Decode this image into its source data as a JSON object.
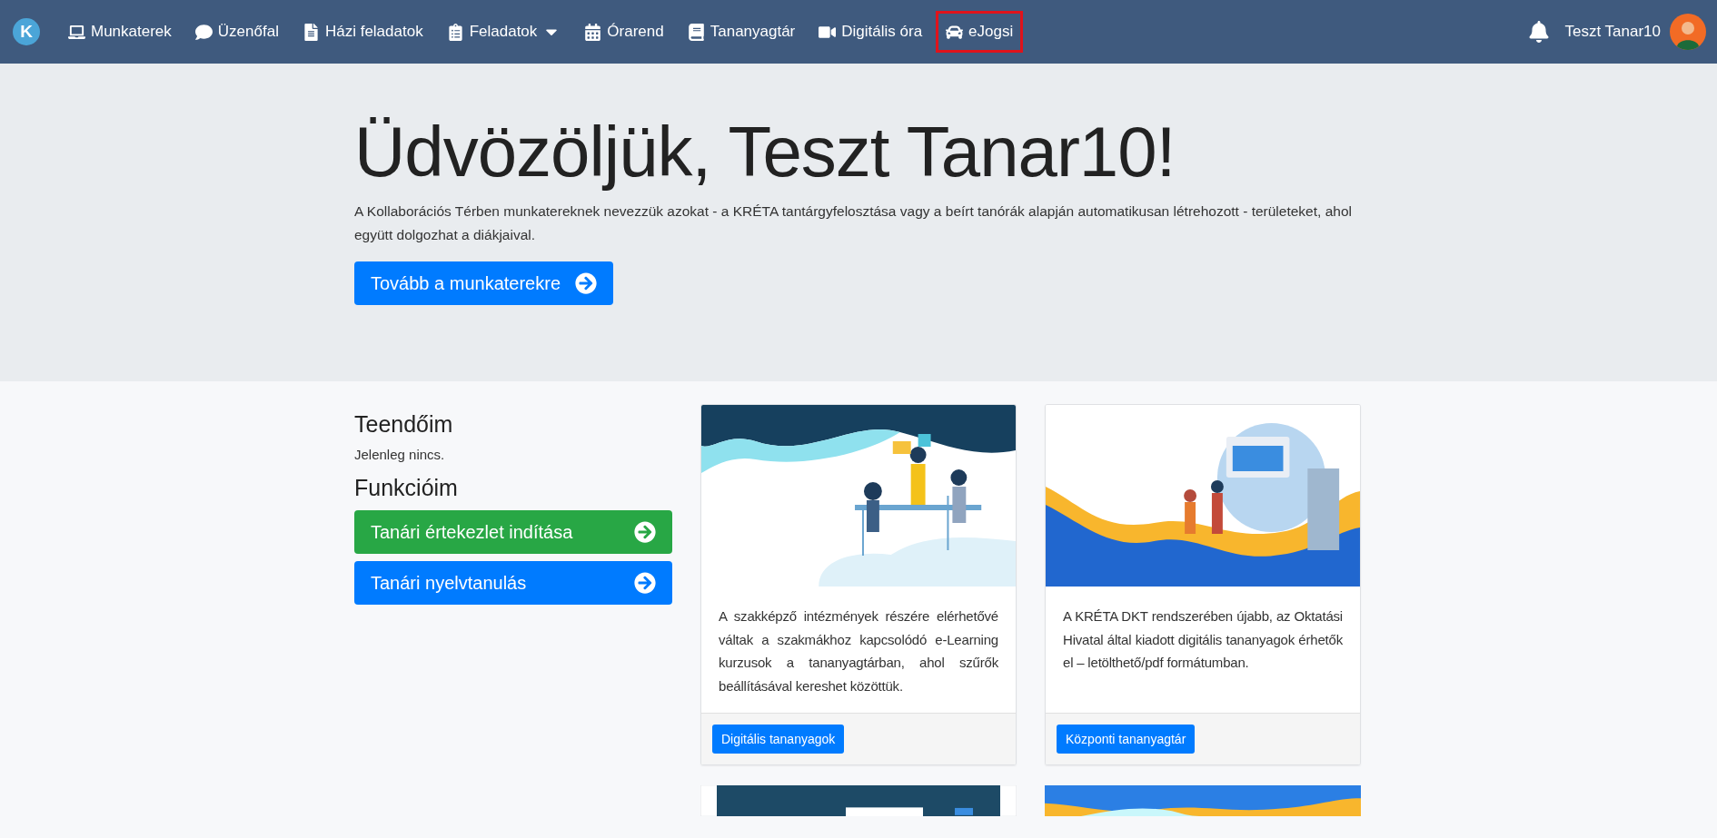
{
  "navbar": {
    "logo": "K",
    "items": [
      {
        "label": "Munkaterek",
        "kind": "link",
        "highlighted": false
      },
      {
        "label": "Üzenőfal",
        "kind": "link",
        "highlighted": false
      },
      {
        "label": "Házi feladatok",
        "kind": "link",
        "highlighted": false
      },
      {
        "label": "Feladatok",
        "kind": "dropdown",
        "highlighted": false
      },
      {
        "label": "Órarend",
        "kind": "link",
        "highlighted": false
      },
      {
        "label": "Tananyagtár",
        "kind": "link",
        "highlighted": false
      },
      {
        "label": "Digitális óra",
        "kind": "link",
        "highlighted": false
      },
      {
        "label": "eJogsi",
        "kind": "link",
        "highlighted": true
      }
    ],
    "user": {
      "name": "Teszt Tanar10"
    }
  },
  "hero": {
    "title": "Üdvözöljük, Teszt Tanar10!",
    "text": "A Kollaborációs Térben munkatereknek nevezzük azokat - a KRÉTA tantárgyfelosztása vagy a beírt tanórák alapján automatikusan létrehozott - területeket, ahol együtt dolgozhat a diákjaival.",
    "button": "Tovább a munkaterekre"
  },
  "sidebar": {
    "todo_title": "Teendőim",
    "todo_text": "Jelenleg nincs.",
    "functions_title": "Funkcióim",
    "functions": [
      {
        "label": "Tanári értekezlet indítása",
        "color": "#28a745"
      },
      {
        "label": "Tanári nyelvtanulás",
        "color": "#007bff"
      }
    ]
  },
  "cards": [
    {
      "text": "A szakképző intézmények részére elérhetővé váltak a szakmákhoz kapcsolódó e-Learning kurzusok a tananyagtárban, ahol szűrők beállításával kereshet közöttük.",
      "button": "Digitális tananyagok"
    },
    {
      "text": "A KRÉTA DKT rendszerében újabb, az Oktatási Hivatal által kiadott digitális tananyagok érhetők el – letölthető/pdf formátumban.",
      "button": "Központi tananyagtár"
    }
  ]
}
